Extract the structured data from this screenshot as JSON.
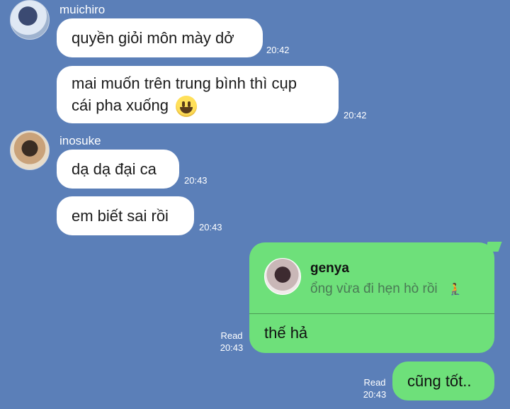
{
  "messages": {
    "muichiro": {
      "sender": "muichiro",
      "msg1": "quyền giỏi môn mày dở",
      "time1": "20:42",
      "msg2_line1": "mai muốn trên trung bình thì cụp",
      "msg2_line2": "cái pha xuống",
      "time2": "20:42"
    },
    "inosuke": {
      "sender": "inosuke",
      "msg1": "dạ dạ đại ca",
      "time1": "20:43",
      "msg2": "em biết sai rồi",
      "time2": "20:43"
    },
    "me": {
      "reply_name": "genya",
      "reply_text": "ổng vừa đi hẹn hò rồi",
      "msg1": "thế hả",
      "read1": "Read",
      "time1": "20:43",
      "msg2": "cũng tốt..",
      "read2": "Read",
      "time2": "20:43"
    }
  },
  "colors": {
    "background": "#5b7fb8",
    "incoming_bubble": "#ffffff",
    "outgoing_bubble": "#6ee07a"
  },
  "icons": {
    "emoji": "grinning-face-emoji",
    "reply_emoji": "person-kneeling-emoji"
  }
}
